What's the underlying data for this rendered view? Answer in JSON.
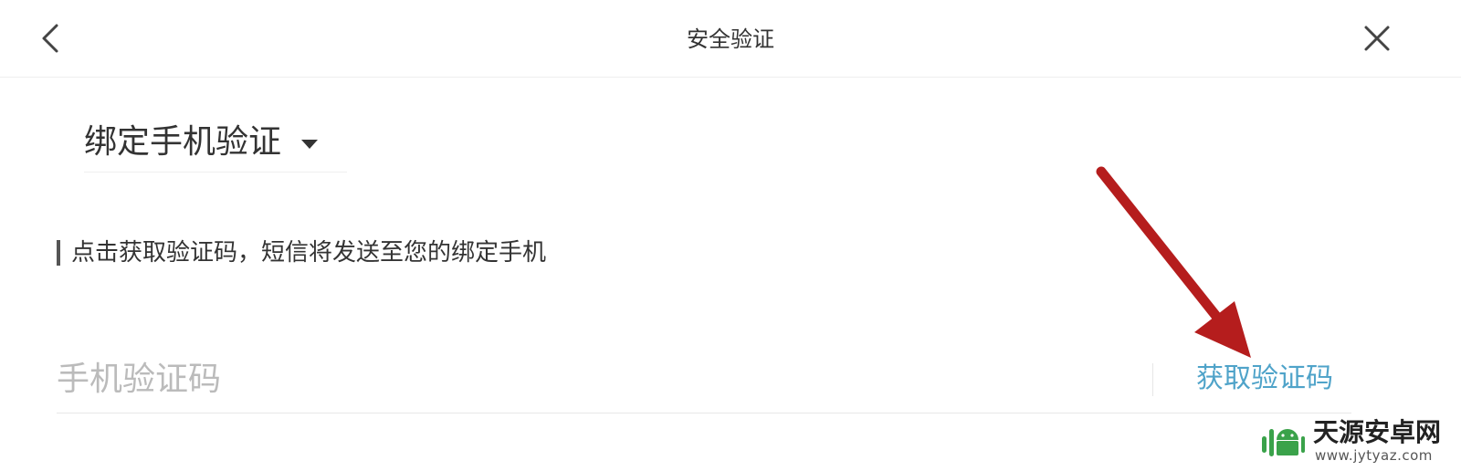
{
  "header": {
    "title": "安全验证",
    "back_icon": "chevron-left-icon",
    "close_icon": "close-icon"
  },
  "verify_method": {
    "selected": "绑定手机验证",
    "caret_icon": "caret-down-icon"
  },
  "hint": {
    "text": "点击获取验证码，短信将发送至您的绑定手机"
  },
  "sms_code": {
    "value": "",
    "placeholder": "手机验证码",
    "get_code_label": "获取验证码"
  },
  "colors": {
    "accent": "#4fa3c9",
    "text": "#333333",
    "placeholder": "#bbbbbb",
    "annotation_arrow": "#b51d1d",
    "watermark_green": "#3aa24a"
  },
  "watermark": {
    "name": "天源安卓网",
    "url": "www.jytyaz.com"
  }
}
